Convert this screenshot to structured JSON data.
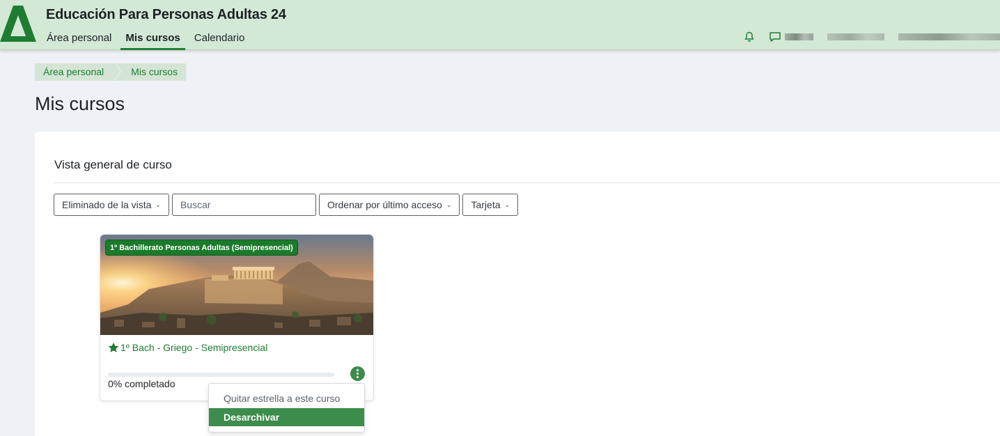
{
  "header": {
    "site_name": "Educación Para Personas Adultas 24",
    "nav": [
      "Área personal",
      "Mis cursos",
      "Calendario"
    ],
    "active_nav": "Mis cursos",
    "brand_color": "#1e7d32",
    "icons": [
      "bell-icon",
      "chat-icon"
    ]
  },
  "breadcrumb": [
    "Área personal",
    "Mis cursos"
  ],
  "page_title": "Mis cursos",
  "course_overview": {
    "title": "Vista general de curso",
    "filter_label": "Eliminado de la vista",
    "search_placeholder": "Buscar",
    "sort_label": "Ordenar por último acceso",
    "view_label": "Tarjeta"
  },
  "course": {
    "category": "1º Bachillerato Personas Adultas (Semipresencial)",
    "name": "1º Bach - Griego - Semipresencial",
    "starred": true,
    "progress_percent": 0,
    "progress_text": "0% completado"
  },
  "course_menu": {
    "items": [
      "Quitar estrella a este curso",
      "Desarchivar"
    ],
    "highlighted": "Desarchivar"
  }
}
